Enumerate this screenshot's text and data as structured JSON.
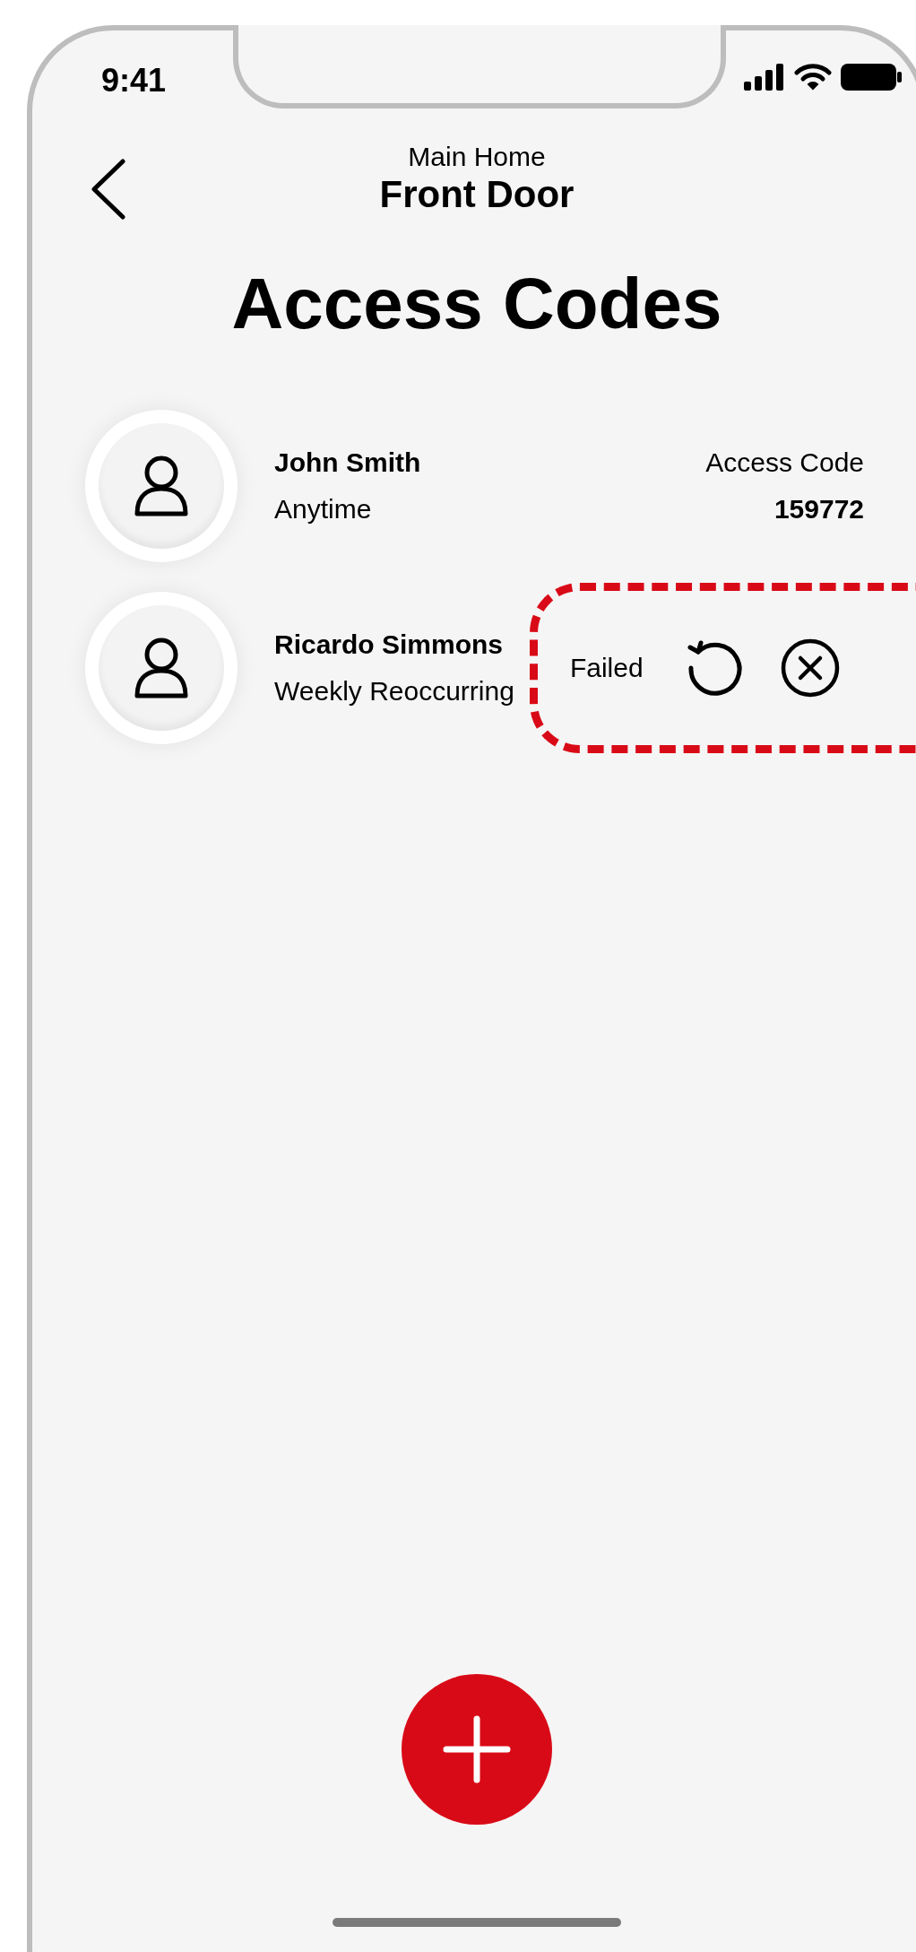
{
  "status_bar": {
    "time": "9:41"
  },
  "header": {
    "subtitle": "Main Home",
    "title": "Front Door"
  },
  "page_title": "Access Codes",
  "access_codes": [
    {
      "kind": "code",
      "name": "John Smith",
      "schedule": "Anytime",
      "code_label": "Access Code",
      "code": "159772"
    },
    {
      "kind": "failed",
      "name": "Ricardo Simmons",
      "schedule": "Weekly Reoccurring",
      "status": "Failed",
      "highlighted": true
    }
  ]
}
